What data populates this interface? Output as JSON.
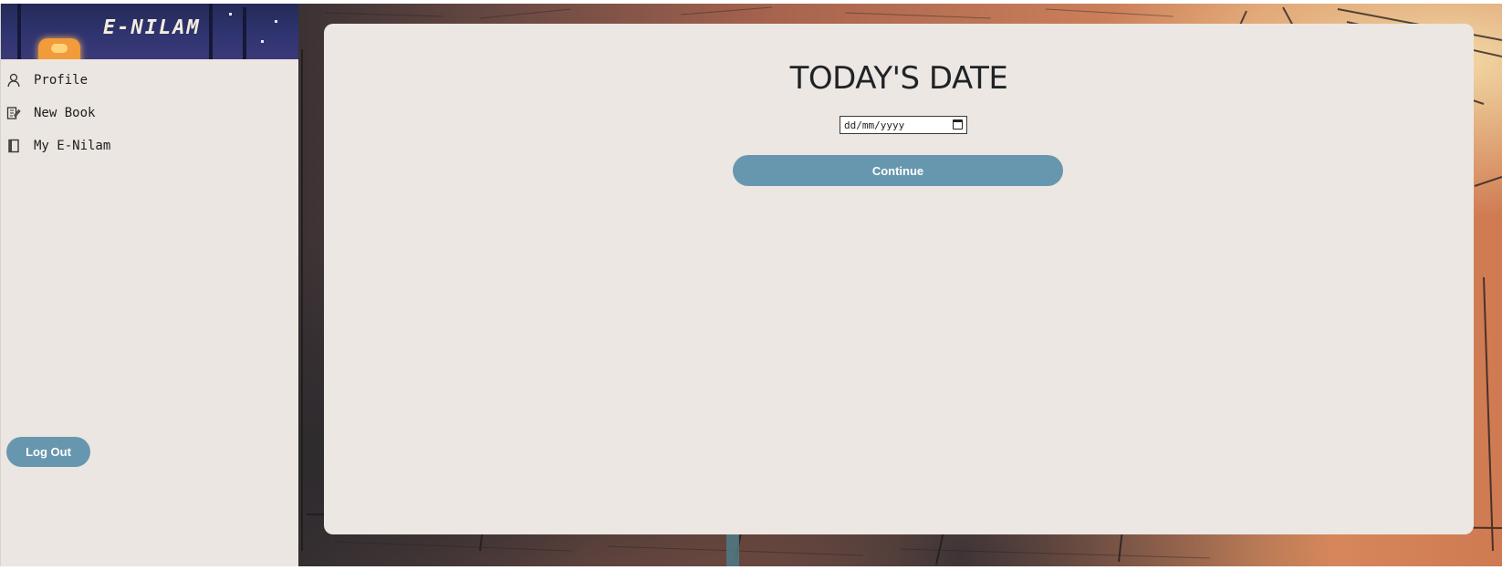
{
  "sidebar": {
    "banner_title": "E-NILAM",
    "items": [
      {
        "label": "Profile",
        "icon": "user-icon"
      },
      {
        "label": "New Book",
        "icon": "edit-book-icon"
      },
      {
        "label": "My E-Nilam",
        "icon": "book-icon"
      }
    ],
    "logout_label": "Log Out"
  },
  "main": {
    "title": "TODAY'S DATE",
    "date_field": {
      "placeholder": "dd/mm/yyyy",
      "icon": "calendar-icon"
    },
    "continue_label": "Continue"
  },
  "colors": {
    "button": "#6797ae",
    "card": "#ece7e2",
    "sidebar": "#ebe6e1",
    "banner": "#2f3470"
  }
}
